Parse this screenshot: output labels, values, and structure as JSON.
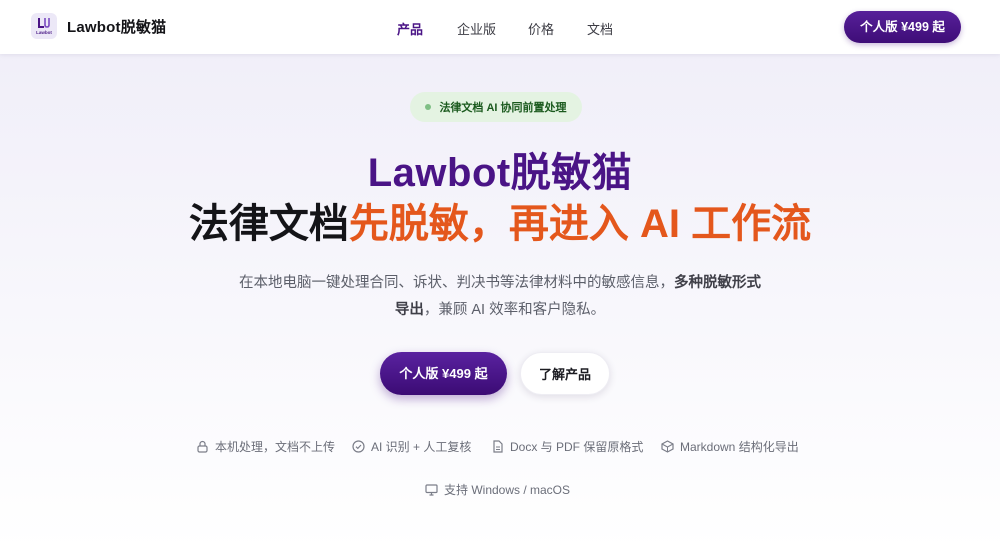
{
  "brand": {
    "logo_text": "Lawbot",
    "name": "Lawbot脱敏猫"
  },
  "nav": {
    "links": [
      {
        "label": "产品",
        "active": true
      },
      {
        "label": "企业版",
        "active": false
      },
      {
        "label": "价格",
        "active": false
      },
      {
        "label": "文档",
        "active": false
      }
    ],
    "cta_label": "个人版 ¥499 起"
  },
  "hero": {
    "badge": "法律文档 AI 协同前置处理",
    "title_line1": "Lawbot脱敏猫",
    "title_line2_part1": "法律文档",
    "title_line2_part2": "先脱敏，再进入 AI 工作流",
    "subtitle_part1": "在本地电脑一键处理合同、诉状、判决书等法律材料中的敏感信息，",
    "subtitle_bold1": "多种脱敏形式",
    "subtitle_bold2": "导出",
    "subtitle_part2": "，兼顾 AI 效率和客户隐私。",
    "primary_button": "个人版 ¥499 起",
    "secondary_button": "了解产品"
  },
  "features": [
    {
      "icon": "lock-icon",
      "label": "本机处理，文档不上传"
    },
    {
      "icon": "check-circle-icon",
      "label": "AI 识别 + 人工复核"
    },
    {
      "icon": "document-icon",
      "label": "Docx 与 PDF 保留原格式"
    },
    {
      "icon": "cube-icon",
      "label": "Markdown 结构化导出"
    },
    {
      "icon": "monitor-icon",
      "label": "支持 Windows / macOS"
    }
  ],
  "colors": {
    "brand_purple": "#4a1486",
    "accent_orange": "#e4571c",
    "badge_bg": "#e4f3e2",
    "badge_text": "#1b5a1e"
  }
}
